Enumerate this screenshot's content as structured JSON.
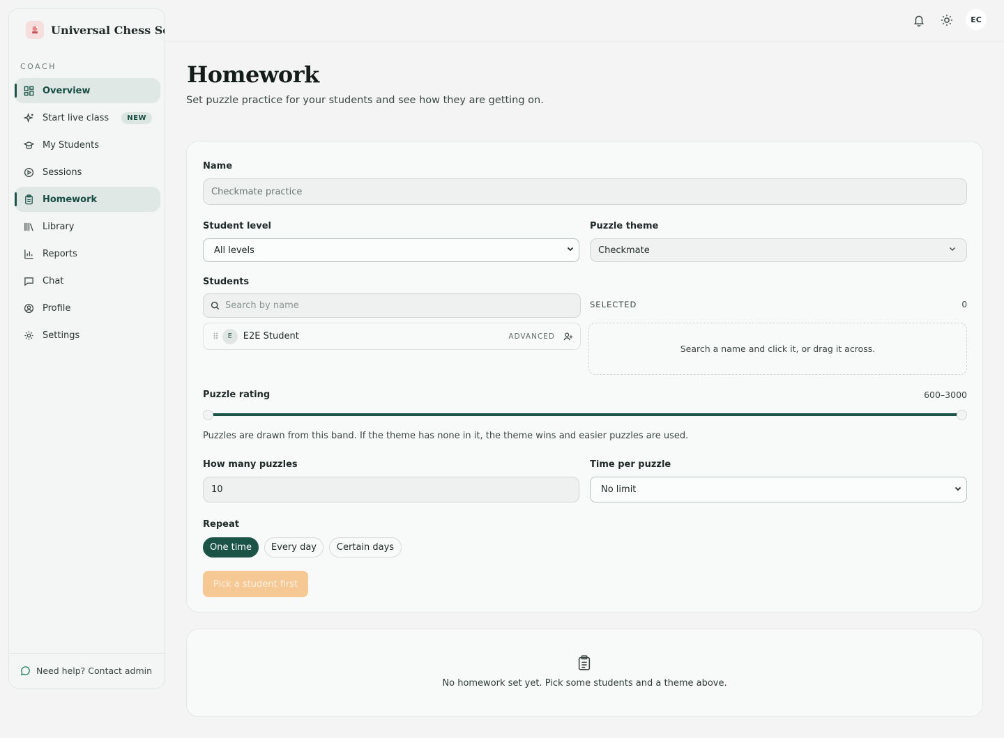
{
  "brand": {
    "name": "Universal Chess School"
  },
  "sidebar": {
    "section": "COACH",
    "items": [
      {
        "label": "Overview",
        "icon": "dashboard-icon",
        "active": true
      },
      {
        "label": "Start live class",
        "icon": "sparkle-icon",
        "badge": "NEW"
      },
      {
        "label": "My Students",
        "icon": "graduation-cap-icon"
      },
      {
        "label": "Sessions",
        "icon": "play-circle-icon"
      },
      {
        "label": "Homework",
        "icon": "clipboard-icon",
        "active": true
      },
      {
        "label": "Library",
        "icon": "library-icon"
      },
      {
        "label": "Reports",
        "icon": "bar-chart-icon"
      },
      {
        "label": "Chat",
        "icon": "chat-bubble-icon"
      },
      {
        "label": "Profile",
        "icon": "user-circle-icon"
      },
      {
        "label": "Settings",
        "icon": "gear-icon"
      }
    ],
    "footer": "Need help? Contact admin"
  },
  "topbar": {
    "avatar": "EC"
  },
  "page": {
    "title": "Homework",
    "subtitle": "Set puzzle practice for your students and see how they are getting on."
  },
  "form": {
    "name_label": "Name",
    "name_placeholder": "Checkmate practice",
    "level_label": "Student level",
    "level_value": "All levels",
    "theme_label": "Puzzle theme",
    "theme_value": "Checkmate",
    "students_label": "Students",
    "search_placeholder": "Search by name",
    "student": {
      "initial": "E",
      "name": "E2E Student",
      "level": "ADVANCED"
    },
    "selected_label": "SELECTED",
    "selected_count": "0",
    "dropzone_text": "Search a name and click it, or drag it across.",
    "rating_label": "Puzzle rating",
    "rating_range": "600–3000",
    "rating_min": 600,
    "rating_max": 3000,
    "rating_help": "Puzzles are drawn from this band. If the theme has none in it, the theme wins and easier puzzles are used.",
    "count_label": "How many puzzles",
    "count_value": "10",
    "time_label": "Time per puzzle",
    "time_value": "No limit",
    "repeat_label": "Repeat",
    "repeat_options": [
      "One time",
      "Every day",
      "Certain days"
    ],
    "repeat_selected": "One time",
    "submit_label": "Pick a student first"
  },
  "empty": {
    "text": "No homework set yet. Pick some students and a theme above."
  },
  "colors": {
    "accent": "#1c5347",
    "submit_disabled": "#f6c994"
  }
}
